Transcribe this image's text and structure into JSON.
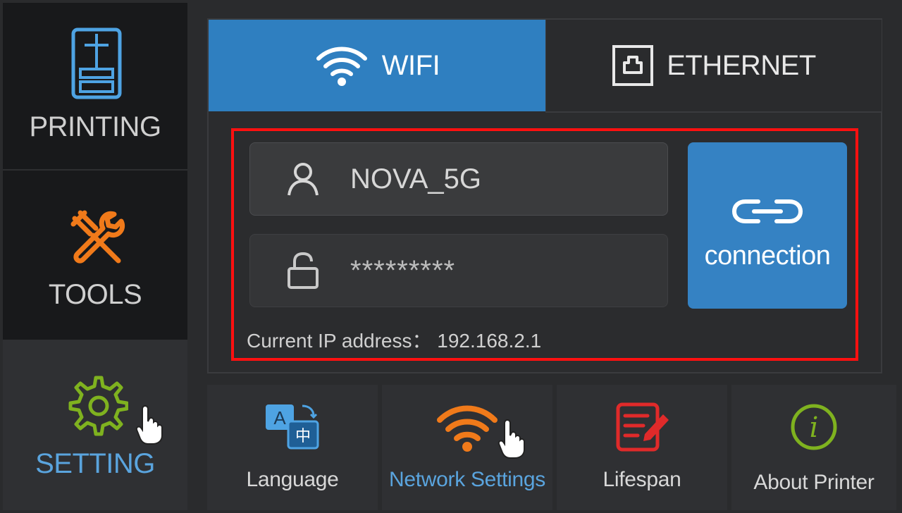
{
  "sidebar": {
    "items": [
      {
        "label": "PRINTING",
        "icon": "printer-icon"
      },
      {
        "label": "TOOLS",
        "icon": "tools-icon"
      },
      {
        "label": "SETTING",
        "icon": "gear-icon",
        "active": true
      }
    ]
  },
  "tabs": [
    {
      "label": "WIFI",
      "icon": "wifi-icon",
      "active": true
    },
    {
      "label": "ETHERNET",
      "icon": "ethernet-port-icon"
    }
  ],
  "network": {
    "ssid_value": "NOVA_5G",
    "password_value": "*********",
    "connect_label": "connection",
    "ip_line": "Current IP address： 192.168.2.1"
  },
  "bottom_menu": [
    {
      "label": "Language",
      "icon": "language-icon"
    },
    {
      "label": "Network Settings",
      "icon": "wifi-icon",
      "active": true
    },
    {
      "label": "Lifespan",
      "icon": "document-edit-icon"
    },
    {
      "label": "About Printer",
      "icon": "info-icon"
    }
  ],
  "colors": {
    "accent_blue": "#2f7fc0",
    "active_text_blue": "#5aa4de",
    "tools_orange": "#f07a1a",
    "setting_green": "#7fb21f",
    "lifespan_red": "#e02a2a",
    "highlight_red": "#ff1010"
  }
}
